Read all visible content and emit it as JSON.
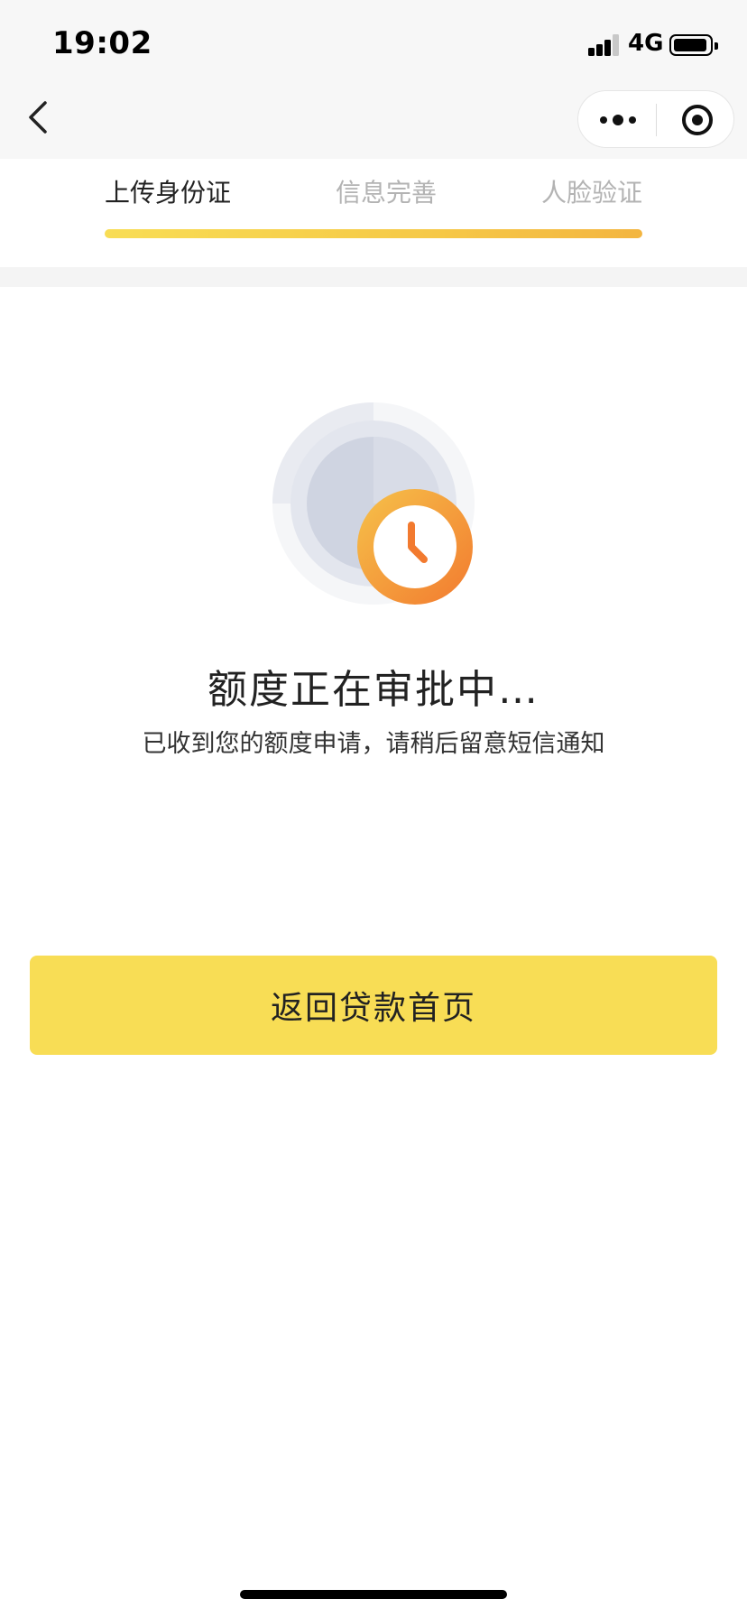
{
  "status_bar": {
    "time": "19:02",
    "network": "4G"
  },
  "nav": {
    "back_icon": "chevron-left-icon",
    "more_icon": "more-dots-icon",
    "close_icon": "target-circle-icon"
  },
  "steps": {
    "items": [
      {
        "label": "上传身份证",
        "active": true
      },
      {
        "label": "信息完善",
        "active": false
      },
      {
        "label": "人脸验证",
        "active": false
      }
    ],
    "progress_colors": [
      "#f8dd55",
      "#f3b540"
    ]
  },
  "status": {
    "icon": "clock-pending-icon",
    "title": "额度正在审批中…",
    "message": "已收到您的额度申请，请稍后留意短信通知"
  },
  "actions": {
    "primary_label": "返回贷款首页",
    "primary_color": "#f8dd55"
  }
}
